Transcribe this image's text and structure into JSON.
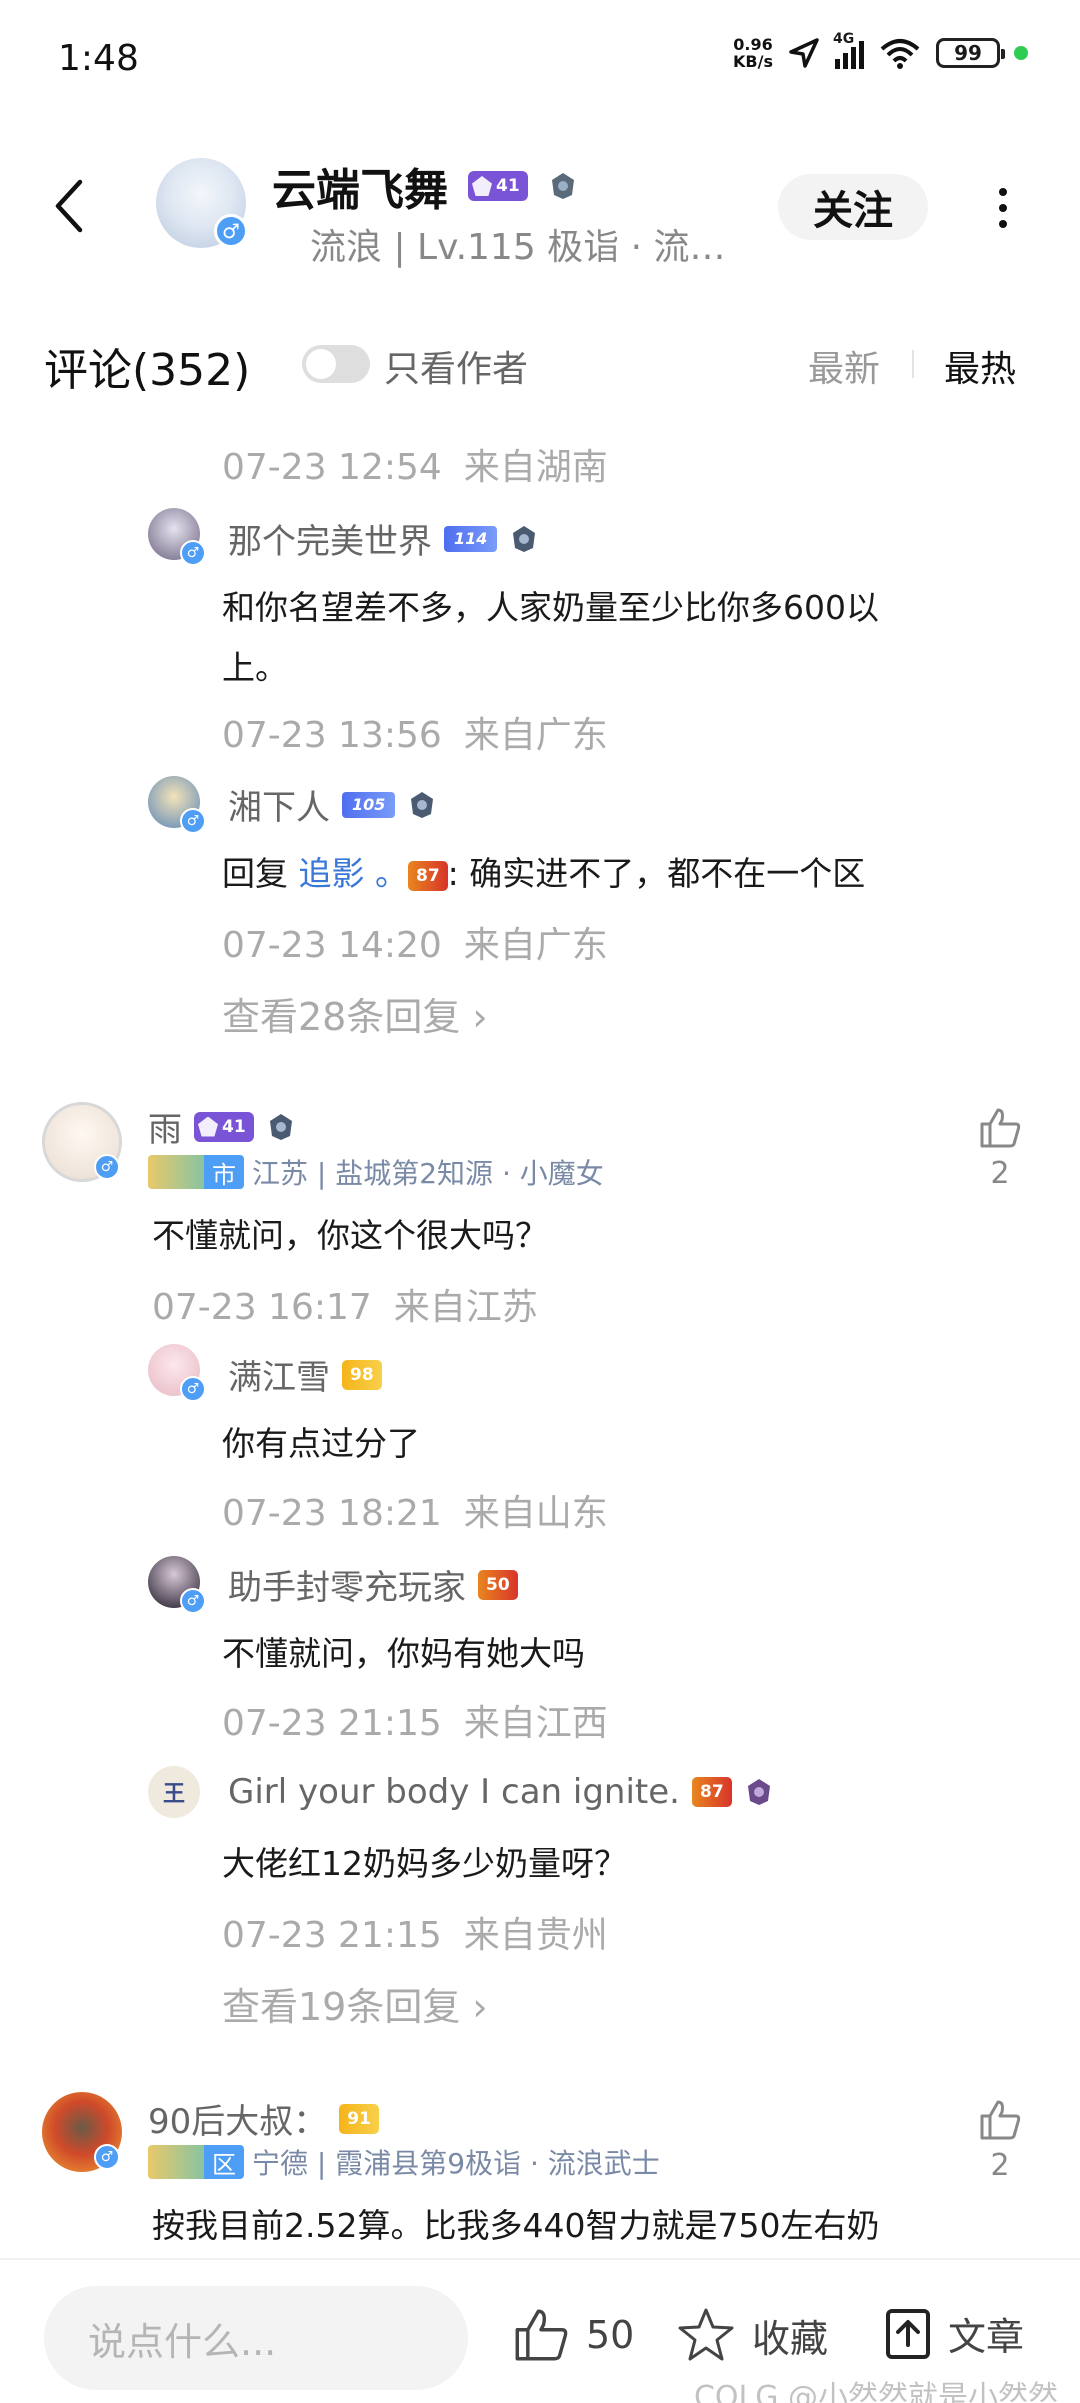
{
  "status": {
    "time": "1:48",
    "net_speed_value": "0.96",
    "net_speed_unit": "KB/s",
    "network": "4G",
    "battery": "99"
  },
  "header": {
    "author_name": "云端飞舞",
    "author_level": "41",
    "author_sub": "流浪 | Lv.115 极诣 · 流…",
    "follow_label": "关注"
  },
  "comments_header": {
    "title": "评论(352)",
    "author_only_label": "只看作者",
    "sort_new": "最新",
    "sort_hot": "最热"
  },
  "thread1": {
    "top_meta": {
      "time": "07-23 12:54",
      "loc": "来自湖南"
    },
    "replies": [
      {
        "name": "那个完美世界",
        "badge": "114",
        "text": "和你名望差不多，人家奶量至少比你多600以",
        "text2": "上。",
        "time": "07-23 13:56",
        "loc": "来自广东"
      },
      {
        "name": "湘下人",
        "badge": "105",
        "reply_prefix": "回复",
        "reply_to": "追影",
        "reply_dot": "。",
        "reply_badge": "87",
        "text": ": 确实进不了，都不在一个区",
        "time": "07-23 14:20",
        "loc": "来自广东"
      }
    ],
    "view_more": "查看28条回复 ›"
  },
  "comment2": {
    "name": "雨",
    "level": "41",
    "region_tag": "市",
    "tag_text": "江苏 | 盐城第2知源 · 小魔女",
    "likes": "2",
    "text": "不懂就问，你这个很大吗？",
    "time": "07-23 16:17",
    "loc": "来自江苏",
    "replies": [
      {
        "name": "满江雪",
        "badge": "98",
        "text": "你有点过分了",
        "time": "07-23 18:21",
        "loc": "来自山东"
      },
      {
        "name": "助手封零充玩家",
        "badge": "50",
        "text": "不懂就问，你妈有她大吗",
        "time": "07-23 21:15",
        "loc": "来自江西"
      },
      {
        "name": "Girl your body I can ignite.",
        "badge": "87",
        "text": "大佬红12奶妈多少奶量呀？",
        "time": "07-23 21:15",
        "loc": "来自贵州"
      }
    ],
    "view_more": "查看19条回复 ›"
  },
  "comment3": {
    "name": "90后大叔：",
    "badge": "91",
    "region_tag": "区",
    "tag_text": "宁德 | 霞浦县第9极诣 · 流浪武士",
    "likes": "2",
    "text": "按我目前2.52算。比我多440智力就是750左右奶"
  },
  "bottom_bar": {
    "input_placeholder": "说点什么...",
    "like_count": "50",
    "favorite_label": "收藏",
    "article_label": "文章"
  },
  "watermark": "COLG @小然然就是小然然"
}
